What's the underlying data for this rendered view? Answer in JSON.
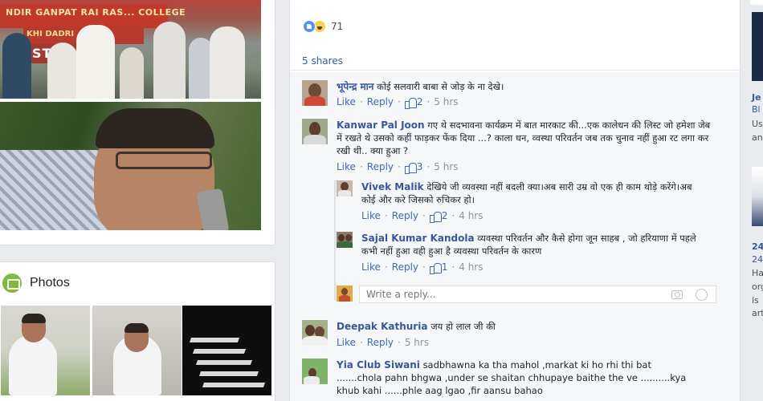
{
  "post": {
    "reaction_count": "71",
    "shares": "5 shares"
  },
  "sidebar": {
    "banner_lines": [
      "NDIR GANPAT RAI RAS... COLLEGE",
      "KHI DADRI",
      "ISTI"
    ],
    "photos_title": "Photos"
  },
  "comments": [
    {
      "author": "भूपेन्द्र मान",
      "text": "कोई सलवारी बाबा से जोड़ के ना देखे।",
      "like": "Like",
      "reply": "Reply",
      "likes": "2",
      "time": "5 hrs"
    },
    {
      "author": "Kanwar Pal Joon",
      "text": "गए थे सदभावना कार्यक्रम में बात मारकाट की...एक कालेधन की लिस्ट जो हमेशा जेब में रखते थे उसको कहीं फाड़कर फेंक दिया ...? काला धन, व्वस्था परिवर्तन जब तक चुनाव नहीं हुआ रट लगा कर रखी थी.. क्या हुआ ?",
      "like": "Like",
      "reply": "Reply",
      "likes": "3",
      "time": "5 hrs",
      "replies": [
        {
          "author": "Vivek Malik",
          "text": "देखिये जी व्यवस्था नहीं बदली क्या।अब सारी उम्र वो एक ही काम थोड़े करेंगे।अब कोई और करे जिसको रुचिकर हो।",
          "like": "Like",
          "reply": "Reply",
          "likes": "2",
          "time": "4 hrs"
        },
        {
          "author": "Sajal Kumar Kandola",
          "text": "व्यवस्था परिवर्तन और कैसे होगा जून साहब , जो हरियाणा में पहले कभी नहीं हुआ वही हुआ है व्यवस्था परिवर्तन के कारण",
          "like": "Like",
          "reply": "Reply",
          "likes": "1",
          "time": "4 hrs"
        }
      ],
      "reply_placeholder": "Write a reply..."
    },
    {
      "author": "Deepak Kathuria",
      "text": "जय हो लाल जी की",
      "like": "Like",
      "reply": "Reply",
      "time": "5 hrs"
    },
    {
      "author": "Yia Club Siwani",
      "text": "sadbhawna ka tha mahol ,markat ki ho rhi thi bat .......chola pahn bhgwa ,under se shaitan chhupaye baithe the ve ..........kya khub kahi ......phle aag lgao ,fir aansu bahao"
    }
  ],
  "right_sidebar": {
    "lines": [
      "Je",
      "Bl",
      "Us",
      "an",
      "24",
      "24",
      "Ha",
      "org",
      "is",
      "art"
    ]
  }
}
